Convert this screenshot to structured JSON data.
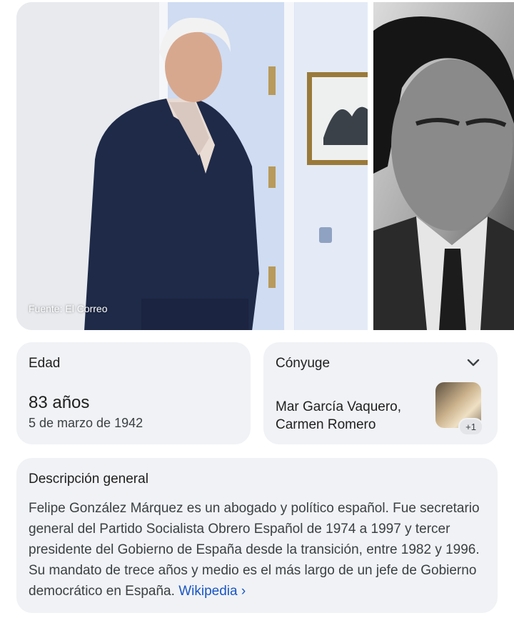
{
  "photos": {
    "source_caption": "Fuente: El Correo"
  },
  "age": {
    "label": "Edad",
    "value": "83 años",
    "birth_date": "5 de marzo de 1942"
  },
  "spouse": {
    "label": "Cónyuge",
    "names_line1": "Mar García Vaquero,",
    "names_line2": "Carmen Romero",
    "more_badge": "+1"
  },
  "description": {
    "title": "Descripción general",
    "text": "Felipe González Márquez es un abogado y político español. Fue secretario general del Partido Socialista Obrero Español de 1974 a 1997 y tercer presidente del Gobierno de España desde la transición, entre 1982 y 1996. Su mandato de trece años y medio es el más largo de un jefe de Gobierno democrático en España.",
    "link": "Wikipedia",
    "link_arrow": "›"
  },
  "colors": {
    "card_background": "#f0f2f5",
    "link": "#1a55c4",
    "text": "#1f1f1f"
  }
}
